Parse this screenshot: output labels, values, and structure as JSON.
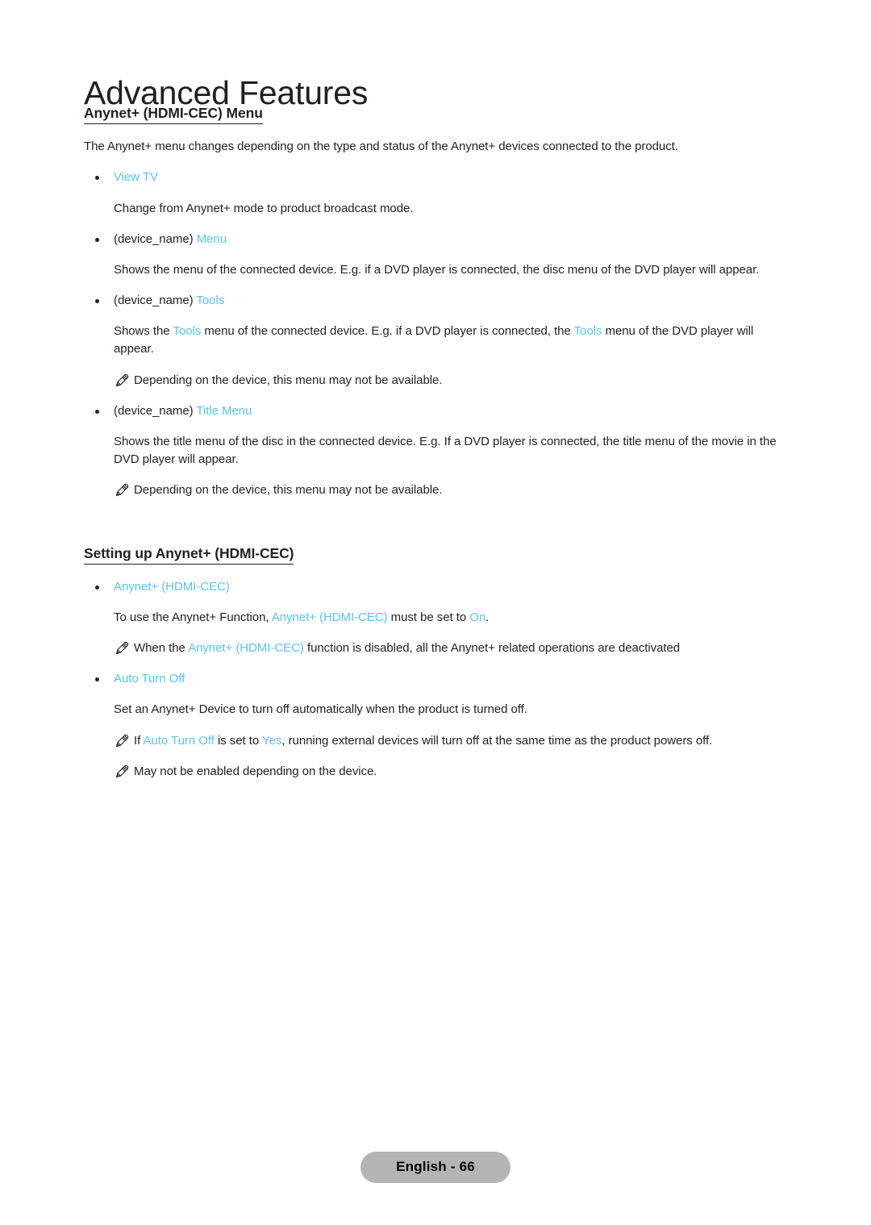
{
  "page": {
    "chapter_title": "Advanced Features",
    "footer_label": "English - 66",
    "accent_color": "#55c5ef",
    "text_color": "#231f20",
    "footer_pill_color": "#b4b4b4"
  },
  "sections": [
    {
      "heading": "Anynet+ (HDMI-CEC) Menu",
      "intro": "The Anynet+ menu changes depending on the type and status of the Anynet+ devices connected to the product.",
      "items": [
        {
          "bullet_prefix": "",
          "bullet_term": "View TV",
          "bullet_suffix": "",
          "description": "Change from Anynet+ mode to product broadcast mode.",
          "notes": []
        },
        {
          "bullet_prefix": "(device_name) ",
          "bullet_term": "Menu",
          "bullet_suffix": "",
          "description": "Shows the menu of the connected device. E.g. if a DVD player is connected, the disc menu of the DVD player will appear.",
          "notes": []
        },
        {
          "bullet_prefix": "(device_name) ",
          "bullet_term": "Tools",
          "bullet_suffix": "",
          "description_parts": [
            {
              "text": "Shows the ",
              "highlight": false
            },
            {
              "text": "Tools",
              "highlight": true
            },
            {
              "text": " menu of the connected device. E.g. if a DVD player is connected, the ",
              "highlight": false
            },
            {
              "text": "Tools",
              "highlight": true
            },
            {
              "text": " menu of the DVD player will appear.",
              "highlight": false
            }
          ],
          "notes": [
            {
              "parts": [
                {
                  "text": "Depending on the device, this menu may not be available.",
                  "highlight": false
                }
              ]
            }
          ]
        },
        {
          "bullet_prefix": "(device_name) ",
          "bullet_term": "Title Menu",
          "bullet_suffix": "",
          "description": "Shows the title menu of the disc in the connected device. E.g. If a DVD player is connected, the title menu of the movie in the DVD player will appear.",
          "notes": [
            {
              "parts": [
                {
                  "text": "Depending on the device, this menu may not be available.",
                  "highlight": false
                }
              ]
            }
          ]
        }
      ]
    },
    {
      "heading": "Setting up Anynet+ (HDMI-CEC)",
      "intro": "",
      "items": [
        {
          "bullet_prefix": "",
          "bullet_term": "Anynet+ (HDMI-CEC)",
          "bullet_suffix": "",
          "description_parts": [
            {
              "text": "To use the Anynet+ Function, ",
              "highlight": false
            },
            {
              "text": "Anynet+ (HDMI-CEC)",
              "highlight": true
            },
            {
              "text": " must be set to ",
              "highlight": false
            },
            {
              "text": "On",
              "highlight": true
            },
            {
              "text": ".",
              "highlight": false
            }
          ],
          "notes": [
            {
              "parts": [
                {
                  "text": "When the ",
                  "highlight": false
                },
                {
                  "text": "Anynet+ (HDMI-CEC)",
                  "highlight": true
                },
                {
                  "text": " function is disabled, all the Anynet+ related operations are deactivated",
                  "highlight": false
                }
              ]
            }
          ]
        },
        {
          "bullet_prefix": "",
          "bullet_term": "Auto Turn Off",
          "bullet_suffix": "",
          "description": "Set an Anynet+ Device to turn off automatically when the product is turned off.",
          "notes": [
            {
              "parts": [
                {
                  "text": "If ",
                  "highlight": false
                },
                {
                  "text": "Auto Turn Off",
                  "highlight": true
                },
                {
                  "text": " is set to ",
                  "highlight": false
                },
                {
                  "text": "Yes",
                  "highlight": true
                },
                {
                  "text": ", running external devices will turn off at the same time as the product powers off.",
                  "highlight": false
                }
              ]
            },
            {
              "parts": [
                {
                  "text": "May not be enabled depending on the device.",
                  "highlight": false
                }
              ]
            }
          ]
        }
      ]
    }
  ]
}
